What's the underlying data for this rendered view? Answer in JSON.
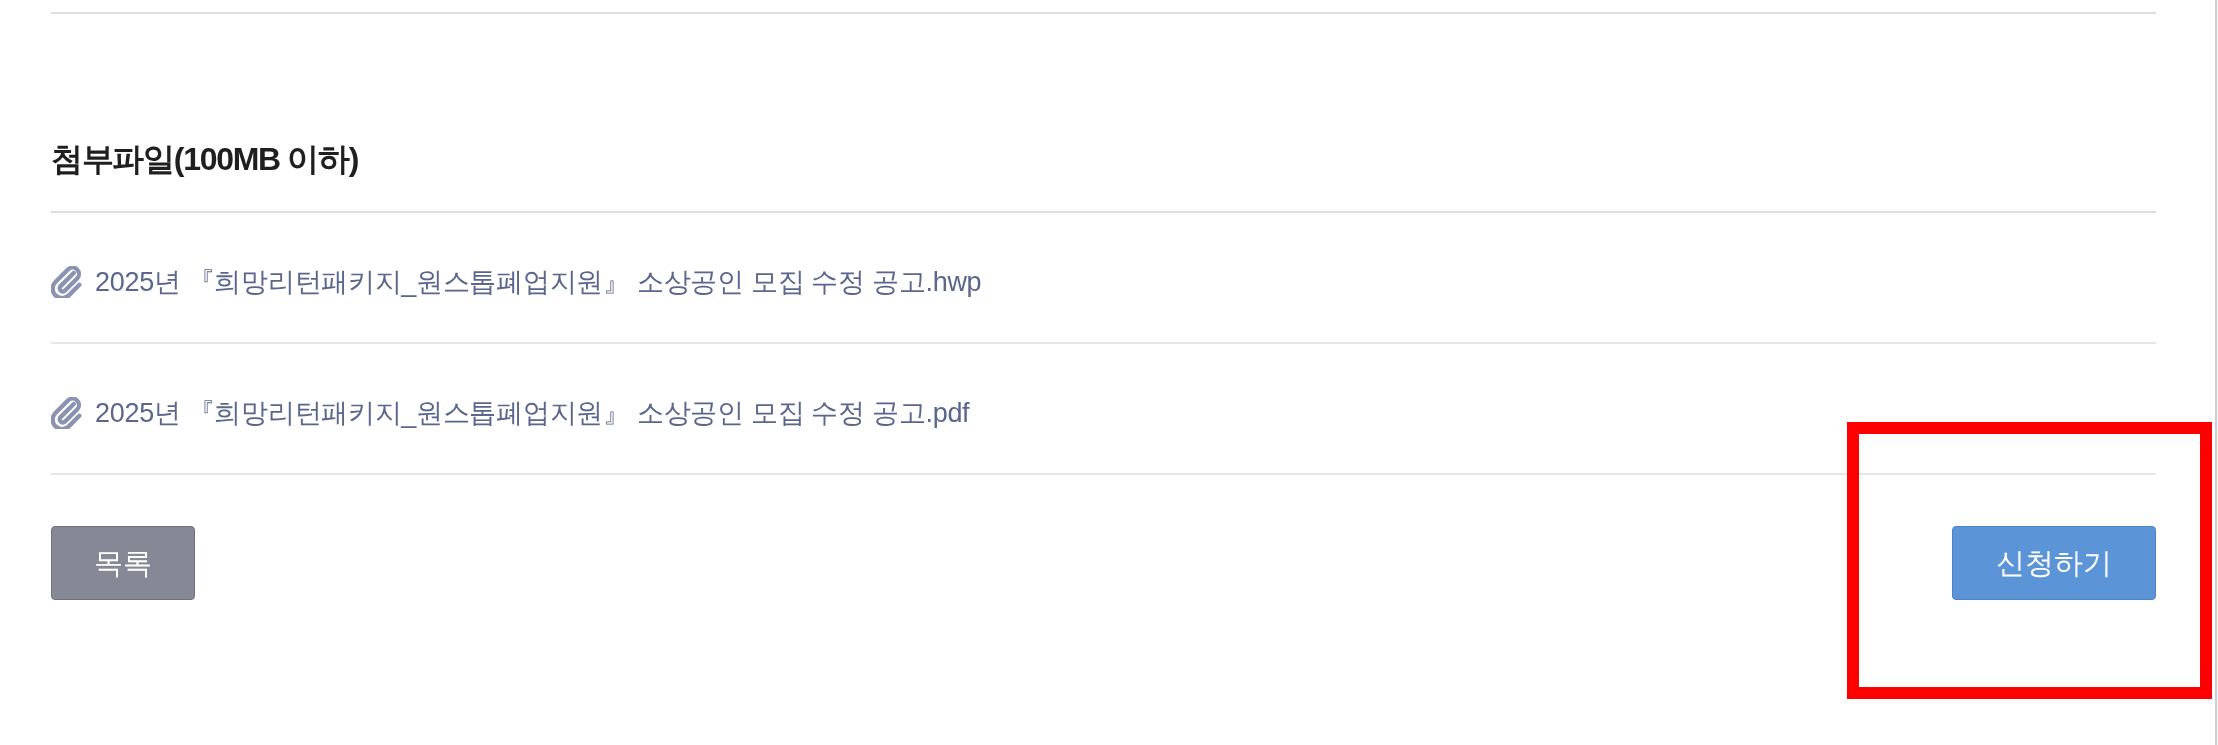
{
  "attachments": {
    "title": "첨부파일(100MB 이하)",
    "files": [
      {
        "name": "2025년 『희망리턴패키지_원스톱폐업지원』 소상공인 모집 수정 공고.hwp"
      },
      {
        "name": "2025년 『희망리턴패키지_원스톱폐업지원』 소상공인 모집 수정 공고.pdf"
      }
    ]
  },
  "actions": [
    {
      "label": "목록",
      "kind": "secondary",
      "highlighted": false
    },
    {
      "label": "신청하기",
      "kind": "primary",
      "highlighted": true
    }
  ]
}
